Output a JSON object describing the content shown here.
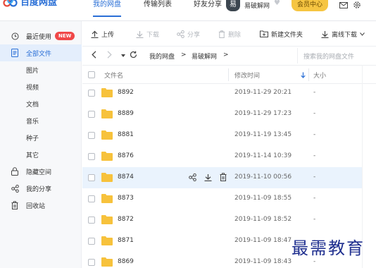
{
  "app": {
    "logo_text": "百度网盘"
  },
  "header": {
    "tabs": [
      {
        "label": "我的网盘",
        "active": true
      },
      {
        "label": "传输列表",
        "active": false
      },
      {
        "label": "好友分享",
        "active": false
      }
    ],
    "avatar_char": "易",
    "username": "易破解网",
    "member_button": "会员中心",
    "icons": [
      "mail-icon",
      "settings-icon"
    ]
  },
  "sidebar": {
    "items": [
      {
        "label": "最近使用",
        "icon": "clock-icon",
        "badge": "NEW"
      },
      {
        "label": "全部文件",
        "icon": "file-icon",
        "active": true
      },
      {
        "label": "图片"
      },
      {
        "label": "视频"
      },
      {
        "label": "文档"
      },
      {
        "label": "音乐"
      },
      {
        "label": "种子"
      },
      {
        "label": "其它"
      },
      {
        "label": "隐藏空间",
        "icon": "lock-icon"
      },
      {
        "label": "我的分享",
        "icon": "share-icon"
      },
      {
        "label": "回收站",
        "icon": "trash-icon"
      }
    ]
  },
  "toolbar": {
    "upload": "上传",
    "download": "下载",
    "share": "分享",
    "delete": "删除",
    "new_folder": "新建文件夹",
    "offline_download": "离线下载"
  },
  "path": {
    "crumbs": [
      "我的网盘",
      "易破解网"
    ],
    "separator": ">",
    "search_placeholder": "搜索我的网盘文件"
  },
  "table": {
    "headers": {
      "name": "文件名",
      "modified": "修改时间",
      "size": "大小"
    },
    "rows": [
      {
        "name": "8892",
        "date": "2019-11-29 20:21",
        "size": "-"
      },
      {
        "name": "8889",
        "date": "2019-11-29 17:23",
        "size": "-"
      },
      {
        "name": "8881",
        "date": "2019-11-19 13:45",
        "size": "-"
      },
      {
        "name": "8876",
        "date": "2019-11-14 10:39",
        "size": "-"
      },
      {
        "name": "8874",
        "date": "2019-11-10 00:56",
        "size": "-",
        "hover": true
      },
      {
        "name": "8873",
        "date": "2019-11-09 18:55",
        "size": "-"
      },
      {
        "name": "8872",
        "date": "2019-11-09 18:52",
        "size": "-"
      },
      {
        "name": "8871",
        "date": "2019-11-09 18:47",
        "size": "-"
      },
      {
        "name": "8869",
        "date": "2019-11-09 18:43",
        "size": "-"
      }
    ]
  },
  "watermark": "最需教育",
  "colors": {
    "accent": "#2a6fd6",
    "folder": "#f7c23c",
    "badge": "#f04848",
    "member": "#f6c542"
  }
}
